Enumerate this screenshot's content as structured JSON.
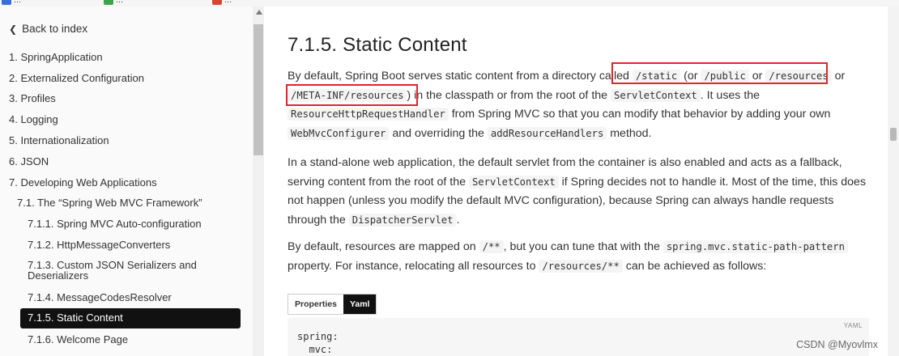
{
  "bookmarks": [
    {
      "label": "...",
      "icon": "bookmark-favicon-blue",
      "color": "#3a6fd8"
    },
    {
      "label": "...",
      "icon": "bookmark-favicon-green",
      "color": "#3fa34d"
    },
    {
      "label": "...",
      "icon": "bookmark-favicon-red",
      "color": "#d9452f"
    }
  ],
  "sidebar": {
    "back_label": "Back to index",
    "back_icon": "chevron-left-icon",
    "items": [
      {
        "label": "1. SpringApplication"
      },
      {
        "label": "2. Externalized Configuration"
      },
      {
        "label": "3. Profiles"
      },
      {
        "label": "4. Logging"
      },
      {
        "label": "5. Internationalization"
      },
      {
        "label": "6. JSON"
      },
      {
        "label": "7. Developing Web Applications"
      },
      {
        "label": "7.1. The “Spring Web MVC Framework”"
      },
      {
        "label": "7.1.1. Spring MVC Auto-configuration"
      },
      {
        "label": "7.1.2. HttpMessageConverters"
      },
      {
        "label": "7.1.3. Custom JSON Serializers and Deserializers"
      },
      {
        "label": "7.1.4. MessageCodesResolver"
      },
      {
        "label": "7.1.5. Static Content"
      },
      {
        "label": "7.1.6. Welcome Page"
      }
    ],
    "active_index": 12
  },
  "content": {
    "title": "7.1.5. Static Content",
    "p1": {
      "t1": "By default, Spring Boot serves static content from a directory called ",
      "c1": "/static",
      "t2": " (or ",
      "c2": "/public",
      "t3": " or ",
      "c3": "/resources",
      "t4": " or ",
      "c4": "/META-INF/resources",
      "t5": ") in the classpath or from the root of the ",
      "c5": "ServletContext",
      "t6": ". It uses the ",
      "c6": "ResourceHttpRequestHandler",
      "t7": " from Spring MVC so that you can modify that behavior by adding your own ",
      "c7": "WebMvcConfigurer",
      "t8": " and overriding the ",
      "c8": "addResourceHandlers",
      "t9": " method."
    },
    "p2": {
      "t1": "In a stand-alone web application, the default servlet from the container is also enabled and acts as a fallback, serving content from the root of the ",
      "c1": "ServletContext",
      "t2": " if Spring decides not to handle it. Most of the time, this does not happen (unless you modify the default MVC configuration), because Spring can always handle requests through the ",
      "c2": "DispatcherServlet",
      "t3": "."
    },
    "p3": {
      "t1": "By default, resources are mapped on ",
      "c1": "/**",
      "t2": ", but you can tune that with the ",
      "c2": "spring.mvc.static-path-pattern",
      "t3": " property. For instance, relocating all resources to ",
      "c3": "/resources/**",
      "t4": " can be achieved as follows:"
    },
    "tabs": [
      {
        "label": "Properties",
        "active": false
      },
      {
        "label": "Yaml",
        "active": true
      }
    ],
    "code": {
      "lang_label": "YAML",
      "lines": [
        "spring:",
        "  mvc:"
      ]
    }
  },
  "highlight_color": "#e0262c",
  "watermark": "CSDN @Myovlmx"
}
